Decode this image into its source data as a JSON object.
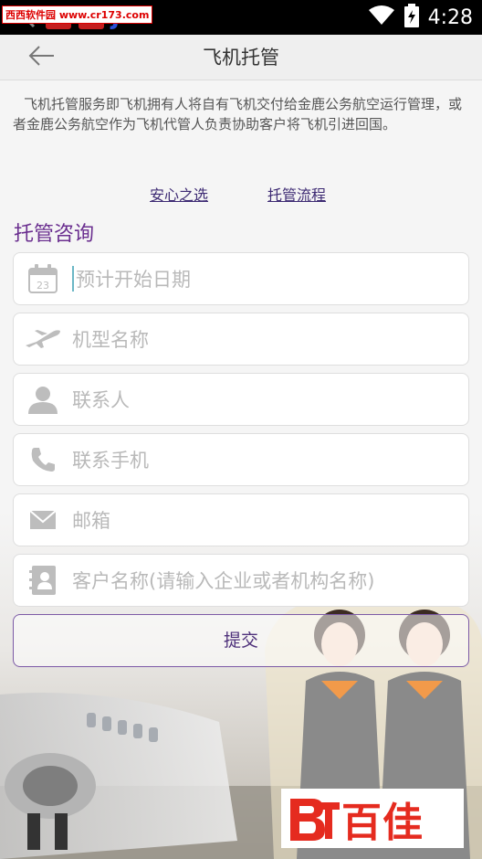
{
  "status_bar": {
    "watermark": "西西软件园 www.cr173.com",
    "app3_label": "J",
    "time": "4:28"
  },
  "header": {
    "title": "飞机托管"
  },
  "intro": {
    "text": "飞机托管服务即飞机拥有人将自有飞机交付给金鹿公务航空运行管理，或者金鹿公务航空作为飞机代管人负责协助客户将飞机引进回国。"
  },
  "links": {
    "peace_of_mind": "安心之选",
    "process": "托管流程"
  },
  "form": {
    "section_title": "托管咨询",
    "fields": [
      {
        "placeholder": "预计开始日期",
        "icon": "calendar-icon",
        "calendar_day": "23"
      },
      {
        "placeholder": "机型名称",
        "icon": "airplane-icon"
      },
      {
        "placeholder": "联系人",
        "icon": "person-icon"
      },
      {
        "placeholder": "联系手机",
        "icon": "phone-icon"
      },
      {
        "placeholder": "邮箱",
        "icon": "envelope-icon"
      },
      {
        "placeholder": "客户名称(请输入企业或者机构名称)",
        "icon": "contact-card-icon"
      }
    ],
    "submit_label": "提交"
  },
  "watermark_logo": {
    "text": "百佳"
  },
  "colors": {
    "accent": "#6a2e8f",
    "link": "#3d2a73",
    "placeholder": "#b9b9b9",
    "icon": "#bdbdbd"
  }
}
